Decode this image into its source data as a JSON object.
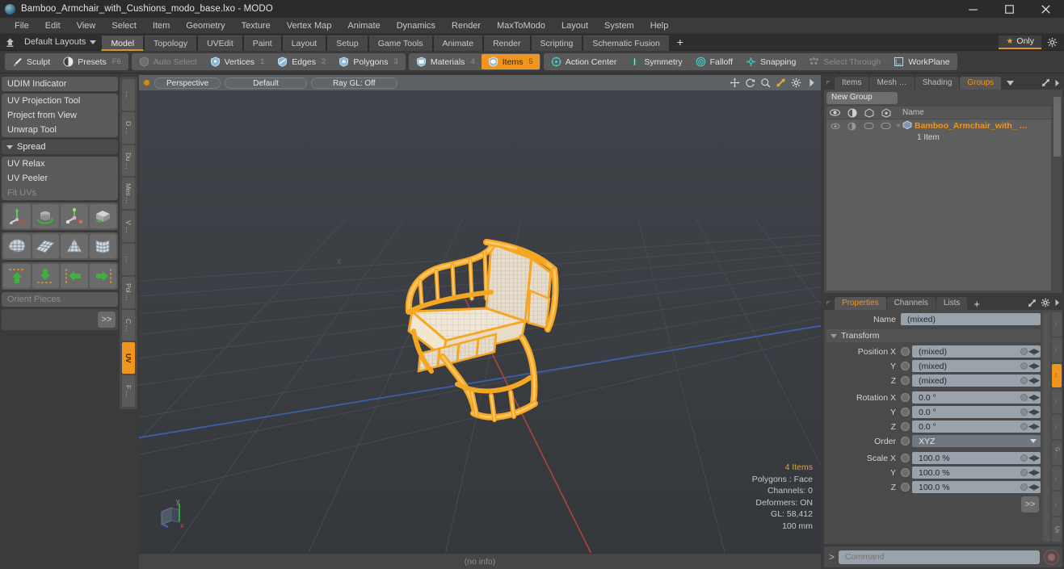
{
  "window": {
    "title": "Bamboo_Armchair_with_Cushions_modo_base.lxo - MODO",
    "logo": "modo-logo-icon",
    "minimize": "minimize-icon",
    "maximize": "maximize-icon",
    "close": "close-icon"
  },
  "menubar": {
    "items": [
      "File",
      "Edit",
      "View",
      "Select",
      "Item",
      "Geometry",
      "Texture",
      "Vertex Map",
      "Animate",
      "Dynamics",
      "Render",
      "MaxToModo",
      "Layout",
      "System",
      "Help"
    ]
  },
  "layoutbar": {
    "home_icon": "home-icon",
    "layout_label": "Default Layouts",
    "tabs": [
      {
        "label": "Model",
        "active": true
      },
      {
        "label": "Topology",
        "active": false
      },
      {
        "label": "UVEdit",
        "active": false
      },
      {
        "label": "Paint",
        "active": false
      },
      {
        "label": "Layout",
        "active": false
      },
      {
        "label": "Setup",
        "active": false
      },
      {
        "label": "Game Tools",
        "active": false
      },
      {
        "label": "Animate",
        "active": false
      },
      {
        "label": "Render",
        "active": false
      },
      {
        "label": "Scripting",
        "active": false
      },
      {
        "label": "Schematic Fusion",
        "active": false
      }
    ],
    "add_tab": "+",
    "only_label": "Only",
    "only_icon": "star-icon",
    "gear_icon": "gear-icon"
  },
  "modebar": {
    "groups": [
      {
        "buttons": [
          {
            "label": "Sculpt",
            "icon": "brush-icon",
            "active": false,
            "dim": false,
            "num": ""
          },
          {
            "label": "Presets",
            "icon": "sphere-icon",
            "active": false,
            "dim": false,
            "num": "F6"
          }
        ]
      },
      {
        "buttons": [
          {
            "label": "Auto Select",
            "icon": "shield-gray-icon",
            "active": false,
            "dim": true,
            "num": ""
          },
          {
            "label": "Vertices",
            "icon": "vertices-icon",
            "active": false,
            "dim": false,
            "num": "1"
          },
          {
            "label": "Edges",
            "icon": "edges-icon",
            "active": false,
            "dim": false,
            "num": "2"
          },
          {
            "label": "Polygons",
            "icon": "polygons-icon",
            "active": false,
            "dim": false,
            "num": "3"
          }
        ]
      },
      {
        "buttons": [
          {
            "label": "Materials",
            "icon": "materials-icon",
            "active": false,
            "dim": false,
            "num": "4"
          },
          {
            "label": "Items",
            "icon": "items-icon",
            "active": true,
            "dim": false,
            "num": "5"
          }
        ]
      },
      {
        "buttons": [
          {
            "label": "Action Center",
            "icon": "action-center-icon",
            "active": false,
            "dim": false,
            "num": ""
          },
          {
            "label": "Symmetry",
            "icon": "symmetry-icon",
            "active": false,
            "dim": false,
            "num": ""
          },
          {
            "label": "Falloff",
            "icon": "falloff-icon",
            "active": false,
            "dim": false,
            "num": ""
          },
          {
            "label": "Snapping",
            "icon": "snapping-icon",
            "active": false,
            "dim": false,
            "num": ""
          },
          {
            "label": "Select Through",
            "icon": "select-through-icon",
            "active": false,
            "dim": true,
            "num": ""
          },
          {
            "label": "WorkPlane",
            "icon": "workplane-icon",
            "active": false,
            "dim": false,
            "num": ""
          }
        ]
      }
    ]
  },
  "left_panel": {
    "rows": [
      {
        "label": "UDIM Indicator",
        "dim": false
      },
      {
        "label": "UV Projection Tool",
        "dim": false
      },
      {
        "label": "Project from View",
        "dim": false
      },
      {
        "label": "Unwrap Tool",
        "dim": false
      }
    ],
    "spread_header": "Spread",
    "rows2": [
      {
        "label": "UV Relax",
        "dim": false
      },
      {
        "label": "UV Peeler",
        "dim": false
      },
      {
        "label": "Fit UVs",
        "dim": true
      }
    ],
    "icon_rows": [
      [
        "uv-move-tool-icon",
        "uv-rotate-tool-icon",
        "uv-scale-tool-icon",
        "uv-transform-tool-icon"
      ],
      [
        "uv-sphere-map-icon",
        "uv-planar-grid-icon",
        "uv-cone-map-icon",
        "uv-cylinder-map-icon"
      ],
      [
        "uv-align-up-icon",
        "uv-align-down-icon",
        "uv-align-left-icon",
        "uv-align-right-icon"
      ]
    ],
    "orient_label": "Orient Pieces",
    "more_label": ">>",
    "vtabs": [
      {
        "label": "…",
        "active": false
      },
      {
        "label": "D …",
        "active": false
      },
      {
        "label": "Du …",
        "active": false
      },
      {
        "label": "Mes …",
        "active": false
      },
      {
        "label": "V …",
        "active": false
      },
      {
        "label": "…",
        "active": false
      },
      {
        "label": "Pol …",
        "active": false
      },
      {
        "label": "C …",
        "active": false
      },
      {
        "label": "UV",
        "active": true
      },
      {
        "label": "F …",
        "active": false
      }
    ]
  },
  "viewport": {
    "dot": "viewport-active-dot",
    "pills": [
      "Perspective",
      "Default",
      "Ray GL: Off"
    ],
    "icons": [
      "pan-icon",
      "rotate-icon",
      "zoom-icon",
      "fit-icon",
      "gear-icon",
      "chevron-right-icon"
    ],
    "axis_gizmo": "axis-gizmo-icon",
    "model": "bamboo-armchair-wireframe",
    "stats": {
      "items": "4 Items",
      "polygons": "Polygons : Face",
      "channels": "Channels: 0",
      "deformers": "Deformers: ON",
      "gl": "GL: 58,412",
      "scale": "100 mm"
    },
    "status": "(no info)"
  },
  "right_panel": {
    "top": {
      "tabs": [
        {
          "label": "Items",
          "active": false
        },
        {
          "label": "Mesh …",
          "active": false
        },
        {
          "label": "Shading",
          "active": false
        },
        {
          "label": "Groups",
          "active": true
        }
      ],
      "dropdown_icon": "chevron-down-icon",
      "expand_icon": "expand-icon",
      "more_icon": "chevron-right-icon",
      "new_group_label": "New Group",
      "columns": [
        "eye-icon",
        "render-icon",
        "wireframe-icon",
        "shading-icon"
      ],
      "name_header": "Name",
      "item": {
        "icon": "group-item-icon",
        "name": "Bamboo_Armchair_with_ …",
        "count": "1 Item"
      }
    },
    "properties": {
      "tabs": [
        {
          "label": "Properties",
          "active": true
        },
        {
          "label": "Channels",
          "active": false
        },
        {
          "label": "Lists",
          "active": false
        }
      ],
      "add_tab": "+",
      "expand_icon": "expand-icon",
      "gear_icon": "gear-icon",
      "more_icon": "chevron-right-icon",
      "name_label": "Name",
      "name_value": "(mixed)",
      "transform_header": "Transform",
      "fields": [
        {
          "label": "Position X",
          "value": "(mixed)",
          "type": "num"
        },
        {
          "label": "Y",
          "value": "(mixed)",
          "type": "num"
        },
        {
          "label": "Z",
          "value": "(mixed)",
          "type": "num"
        },
        {
          "label": "Rotation X",
          "value": "0.0 °",
          "type": "num"
        },
        {
          "label": "Y",
          "value": "0.0 °",
          "type": "num"
        },
        {
          "label": "Z",
          "value": "0.0 °",
          "type": "num"
        },
        {
          "label": "Order",
          "value": "XYZ",
          "type": "select"
        },
        {
          "label": "Scale X",
          "value": "100.0 %",
          "type": "num"
        },
        {
          "label": "Y",
          "value": "100.0 %",
          "type": "num"
        },
        {
          "label": "Z",
          "value": "100.0 %",
          "type": "num"
        }
      ],
      "more_label": ">>",
      "vtabs": [
        {
          "label": "…",
          "active": false
        },
        {
          "label": "…",
          "active": false
        },
        {
          "label": "…",
          "active": true
        },
        {
          "label": "…",
          "active": false
        },
        {
          "label": "…",
          "active": false
        },
        {
          "label": "G …",
          "active": false
        },
        {
          "label": "…",
          "active": false
        },
        {
          "label": "…",
          "active": false
        },
        {
          "label": "Us",
          "active": false
        }
      ]
    },
    "command": {
      "prompt": ">",
      "placeholder": "Command",
      "record_icon": "record-icon"
    }
  },
  "colors": {
    "accent": "#f0951e",
    "selection": "#f5a623",
    "panel": "#4a4a4a",
    "background": "#3b3b3b",
    "viewport": "#3c3f43"
  }
}
